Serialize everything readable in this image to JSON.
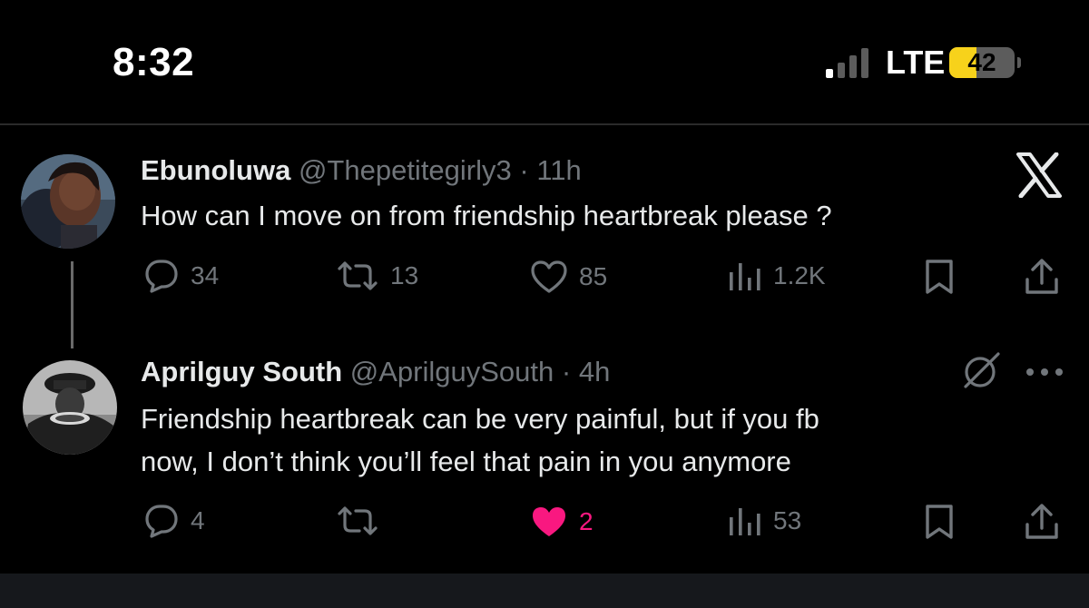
{
  "status_bar": {
    "time": "8:32",
    "network": "LTE",
    "battery_level": "42",
    "battery_fraction": 0.42
  },
  "tweets": [
    {
      "display_name": "Ebunoluwa",
      "handle": "@Thepetitegirly3",
      "separator": "·",
      "time": "11h",
      "text": "How can I move on from friendship heartbreak please ?",
      "replies": "34",
      "reposts": "13",
      "likes": "85",
      "views": "1.2K",
      "liked": false
    },
    {
      "display_name": "Aprilguy South",
      "handle": "@AprilguySouth",
      "separator": "·",
      "time": "4h",
      "text_lines": [
        "Friendship heartbreak can be very painful, but if you fb",
        "now, I don’t think you’ll feel that pain in you anymore"
      ],
      "replies": "4",
      "reposts": "",
      "likes": "2",
      "views": "53",
      "liked": true
    }
  ],
  "icons": {
    "brand": "x-logo",
    "reply": "comment-bubble",
    "repost": "repost-arrows",
    "like": "heart",
    "views": "bar-chart",
    "bookmark": "bookmark",
    "share": "share-upload",
    "grok": "grok-slash-circle",
    "more": "ellipsis"
  },
  "colors": {
    "background": "#000000",
    "text_primary": "#e7e9ea",
    "text_secondary": "#71767b",
    "like_active": "#f91880",
    "battery": "#f7d21b"
  }
}
